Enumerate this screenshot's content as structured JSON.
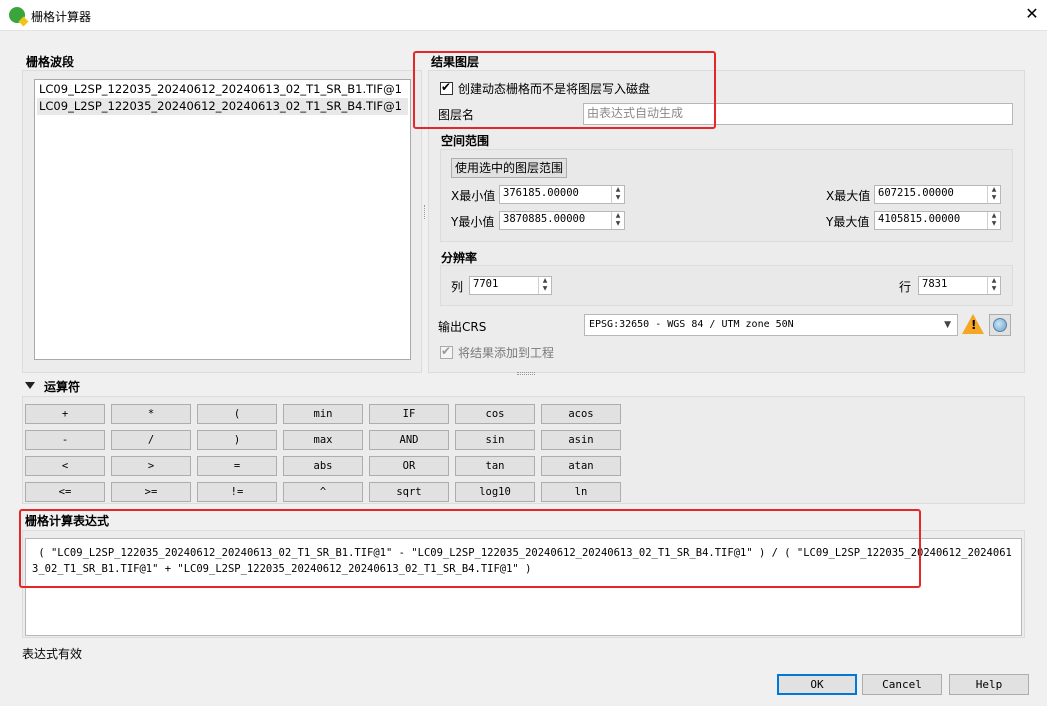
{
  "window": {
    "title": "栅格计算器",
    "close_glyph": "✕"
  },
  "bands": {
    "title": "栅格波段",
    "items": [
      "LC09_L2SP_122035_20240612_20240613_02_T1_SR_B1.TIF@1",
      "LC09_L2SP_122035_20240612_20240613_02_T1_SR_B4.TIF@1"
    ]
  },
  "result_layer": {
    "title": "结果图层",
    "virtual_checkbox_label": "创建动态栅格而不是将图层写入磁盘",
    "virtual_checked": true,
    "layer_name_label": "图层名",
    "layer_name_placeholder": "由表达式自动生成"
  },
  "extent": {
    "title": "空间范围",
    "use_selected_button": "使用选中的图层范围",
    "xmin_label": "X最小值",
    "xmin_value": "376185.00000",
    "xmax_label": "X最大值",
    "xmax_value": "607215.00000",
    "ymin_label": "Y最小值",
    "ymin_value": "3870885.00000",
    "ymax_label": "Y最大值",
    "ymax_value": "4105815.00000"
  },
  "resolution": {
    "title": "分辨率",
    "columns_label": "列",
    "columns_value": "7701",
    "rows_label": "行",
    "rows_value": "7831"
  },
  "output_crs": {
    "label": "输出CRS",
    "value": "EPSG:32650 - WGS 84 / UTM zone 50N"
  },
  "add_to_project": {
    "label": "将结果添加到工程",
    "checked": true
  },
  "operators": {
    "title": "运算符",
    "rows": [
      [
        "+",
        "*",
        "(",
        "min",
        "IF",
        "cos",
        "acos"
      ],
      [
        "-",
        "/",
        ")",
        "max",
        "AND",
        "sin",
        "asin"
      ],
      [
        "<",
        ">",
        "=",
        "abs",
        "OR",
        "tan",
        "atan"
      ],
      [
        "<=",
        ">=",
        "!=",
        "^",
        "sqrt",
        "log10",
        "ln"
      ]
    ]
  },
  "expression": {
    "title": "栅格计算表达式",
    "text": " ( \"LC09_L2SP_122035_20240612_20240613_02_T1_SR_B1.TIF@1\" - \"LC09_L2SP_122035_20240612_20240613_02_T1_SR_B4.TIF@1\" ) / ( \"LC09_L2SP_122035_20240612_20240613_02_T1_SR_B1.TIF@1\" + \"LC09_L2SP_122035_20240612_20240613_02_T1_SR_B4.TIF@1\" )",
    "status": "表达式有效"
  },
  "buttons": {
    "ok": "OK",
    "cancel": "Cancel",
    "help": "Help"
  },
  "colors": {
    "annotation_highlight": "#e62727",
    "warning": "#f5a623"
  }
}
